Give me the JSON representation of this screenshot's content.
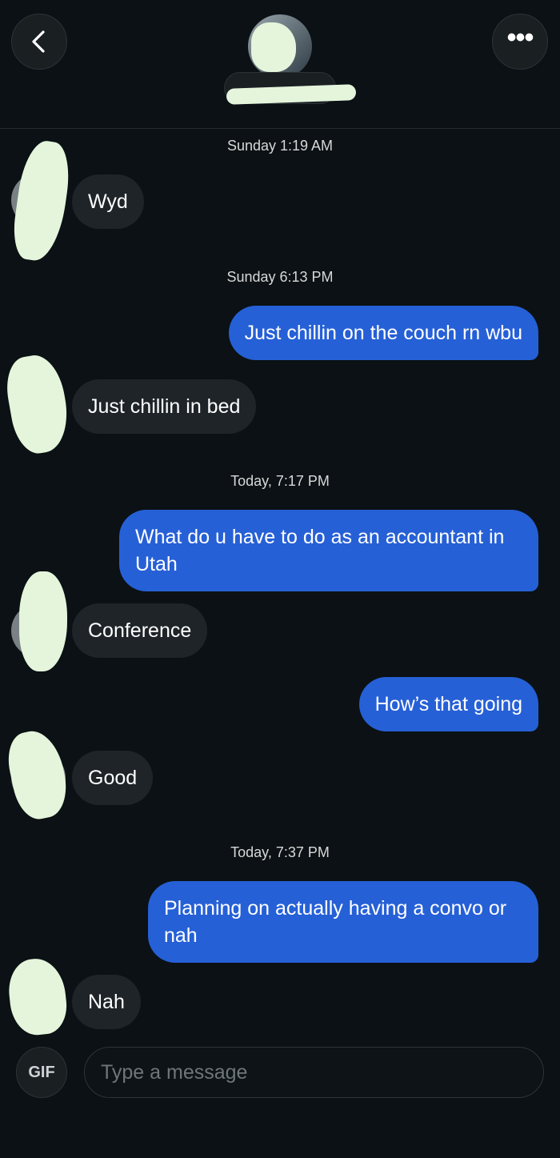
{
  "header": {
    "back_icon": "chevron-left-icon",
    "more_icon": "more-horizontal-icon",
    "more_glyph": "•••"
  },
  "messages": [
    {
      "type": "timestamp",
      "text": "Sunday 1:19 AM"
    },
    {
      "type": "incoming",
      "text": "Wyd"
    },
    {
      "type": "timestamp",
      "text": "Sunday 6:13 PM"
    },
    {
      "type": "outgoing",
      "text": "Just chillin on the couch rn wbu"
    },
    {
      "type": "incoming",
      "text": "Just chillin in bed"
    },
    {
      "type": "timestamp",
      "text": "Today, 7:17 PM"
    },
    {
      "type": "outgoing",
      "text": "What do u have to do as an accountant in Utah"
    },
    {
      "type": "incoming",
      "text": "Conference"
    },
    {
      "type": "outgoing",
      "text": "How’s that going"
    },
    {
      "type": "incoming",
      "text": "Good"
    },
    {
      "type": "timestamp",
      "text": "Today, 7:37 PM"
    },
    {
      "type": "outgoing",
      "text": "Planning on actually having a convo or nah"
    },
    {
      "type": "incoming",
      "text": "Nah"
    }
  ],
  "composer": {
    "gif_label": "GIF",
    "placeholder": "Type a message"
  },
  "colors": {
    "background": "#0b1114",
    "incoming_bubble": "#1e2428",
    "outgoing_bubble": "#2660d6",
    "redaction": "#e4f5dc"
  }
}
